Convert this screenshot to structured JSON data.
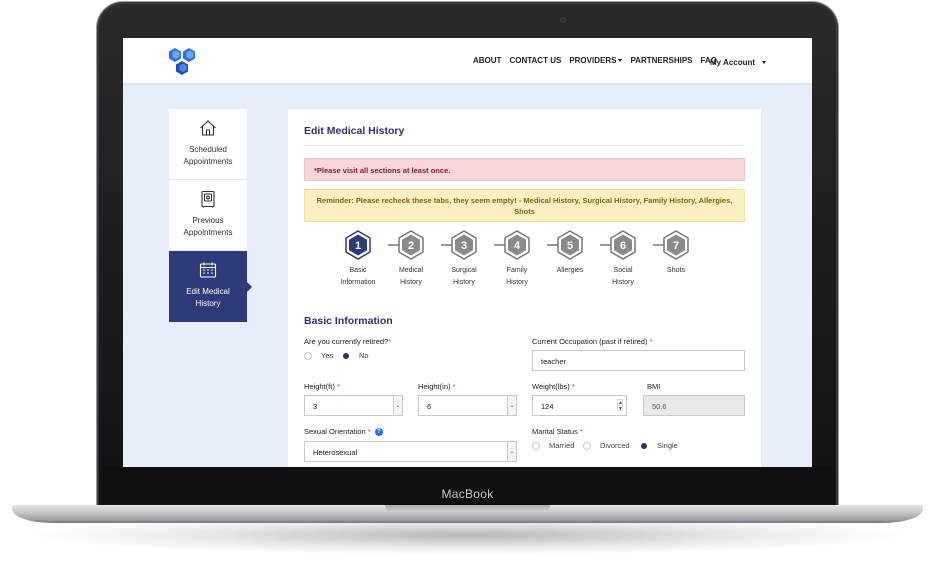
{
  "device": {
    "brand": "MacBook"
  },
  "nav": {
    "items": [
      {
        "label": "ABOUT"
      },
      {
        "label": "CONTACT US"
      },
      {
        "label": "PROVIDERS",
        "has_dropdown": true
      },
      {
        "label": "PARTNERSHIPS"
      },
      {
        "label": "FAQ"
      }
    ],
    "account_label": "My Account"
  },
  "sidebar": {
    "items": [
      {
        "line1": "Scheduled",
        "line2": "Appointments",
        "icon": "home-icon"
      },
      {
        "line1": "Previous",
        "line2": "Appointments",
        "icon": "safe-icon"
      },
      {
        "line1": "Edit Medical",
        "line2": "History",
        "icon": "calendar-icon",
        "active": true
      }
    ]
  },
  "card": {
    "title": "Edit Medical History",
    "alert_error": "*Please visit all sections at least once.",
    "alert_reminder": "Reminder: Please recheck these tabs, they seem empty! - Medical History, Surgical History, Family History, Allergies, Shots"
  },
  "steps": [
    {
      "num": "1",
      "line1": "Basic",
      "line2": "Information",
      "active": true
    },
    {
      "num": "2",
      "line1": "Medical",
      "line2": "History"
    },
    {
      "num": "3",
      "line1": "Surgical",
      "line2": "History"
    },
    {
      "num": "4",
      "line1": "Family",
      "line2": "History"
    },
    {
      "num": "5",
      "line1": "Allergies",
      "line2": ""
    },
    {
      "num": "6",
      "line1": "Social",
      "line2": "History"
    },
    {
      "num": "7",
      "line1": "Shots",
      "line2": ""
    }
  ],
  "form": {
    "section_title": "Basic Information",
    "retired": {
      "label": "Are you currently retired?",
      "required_mark": "*",
      "options": [
        "Yes",
        "No"
      ],
      "selected": "No"
    },
    "occupation": {
      "label": "Current Occupation (past if retired)",
      "required_mark": "*",
      "value": "teacher"
    },
    "height_ft": {
      "label": "Height(ft)",
      "required_mark": "*",
      "value": "3"
    },
    "height_in": {
      "label": "Height(in)",
      "required_mark": "*",
      "value": "6"
    },
    "weight": {
      "label": "Weight(lbs)",
      "required_mark": "*",
      "value": "124"
    },
    "bmi": {
      "label": "BMI",
      "value": "50.6"
    },
    "orientation": {
      "label": "Sexual Orientation",
      "required_mark": "*",
      "help": "?",
      "value": "Heterosexual"
    },
    "marital": {
      "label": "Marital Status",
      "required_mark": "*",
      "options": [
        "Married",
        "Divorced",
        "Single"
      ],
      "selected": "Single"
    }
  },
  "colors": {
    "primary": "#2f3a7a",
    "accent_blue": "#2d6fd6",
    "error_bg": "#f8d7da",
    "warning_bg": "#fbf0c2"
  }
}
